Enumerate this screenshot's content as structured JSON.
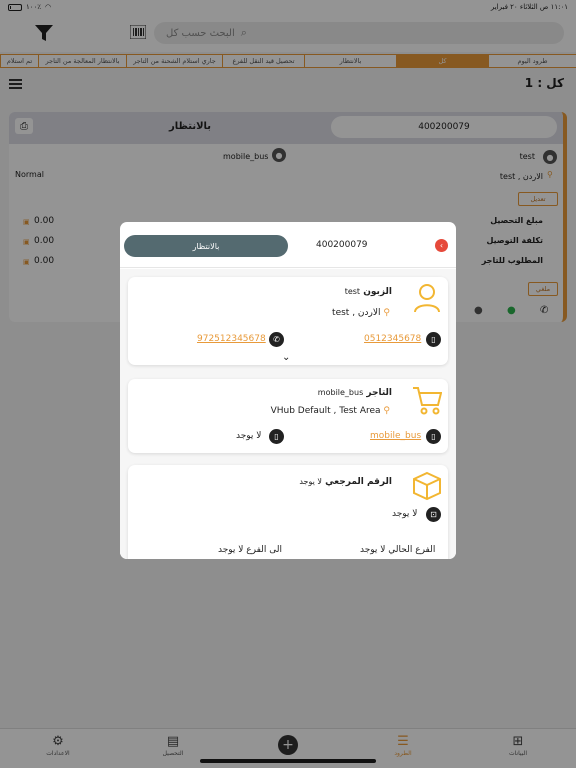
{
  "status_bar": {
    "time_date": "١١:٠١ ص   الثلاثاء ٢٠ فبراير",
    "battery": "١٠٠٪"
  },
  "header": {
    "search_placeholder": "البحث حسب كل"
  },
  "tabs": [
    {
      "label": "طرود اليوم",
      "active": false
    },
    {
      "label": "كل",
      "active": true
    },
    {
      "label": "بالانتظار",
      "active": false
    },
    {
      "label": "تحصيل قيد النقل للفرع",
      "active": false
    },
    {
      "label": "جاري استلام الشحنة من التاجر",
      "active": false
    },
    {
      "label": "بالانتظار المعالجة من التاجر",
      "active": false
    },
    {
      "label": "تم استلام",
      "active": false
    }
  ],
  "count_label": "كل : 1",
  "background_card": {
    "status": "بالانتظار",
    "order_number": "400200079",
    "customer_name": "test",
    "merchant_name": "mobile_bus",
    "address": "الاردن , test",
    "priority": "Normal",
    "edit_label": "تعديل",
    "cancel_label": "ملغي",
    "rows": [
      {
        "label": "مبلغ التحصيل",
        "value": "0.00"
      },
      {
        "label": "تكلفة التوصيل",
        "value": "0.00"
      },
      {
        "label": "المطلوب للتاجر",
        "value": "0.00"
      }
    ]
  },
  "modal": {
    "status": "بالانتظار",
    "order_number": "400200079",
    "customer": {
      "title": "الزبون",
      "name": "test",
      "address": "الاردن , test",
      "phone": "0512345678",
      "whatsapp": "972512345678"
    },
    "merchant": {
      "title": "التاجر",
      "name": "mobile_bus",
      "address": "VHub Default , Test Area",
      "phone": "mobile_bus",
      "second_phone": "لا يوجد"
    },
    "reference": {
      "title": "الرقم المرجعي",
      "value": "لا يوجد",
      "second_value": "لا يوجد",
      "current_branch": "الفرع الحالي لا يوجد",
      "to_branch": "الى الفرع لا يوجد"
    }
  },
  "bottom_bar": [
    {
      "label": "البيانات",
      "icon": "grid-icon",
      "active": false
    },
    {
      "label": "الطرود",
      "icon": "list-icon",
      "active": true
    },
    {
      "label": "",
      "icon": "plus-icon",
      "active": false
    },
    {
      "label": "التحصيل",
      "icon": "document-icon",
      "active": false
    },
    {
      "label": "الاعدادات",
      "icon": "gear-icon",
      "active": false
    }
  ],
  "colors": {
    "accent": "#e89a3a",
    "status_pill": "#546a70",
    "close": "#e64a3b",
    "card_header": "#dcdce6"
  }
}
